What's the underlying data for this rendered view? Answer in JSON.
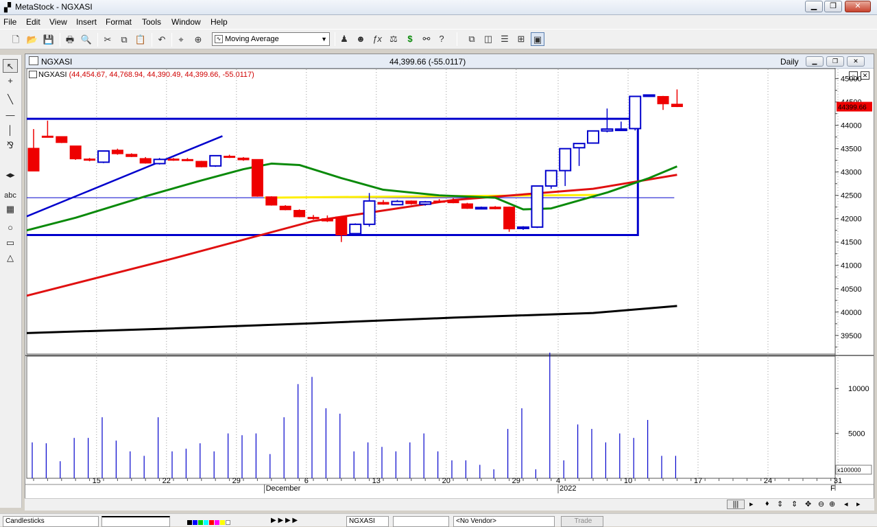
{
  "window": {
    "title": "MetaStock - NGXASI"
  },
  "menu": [
    "File",
    "Edit",
    "View",
    "Insert",
    "Format",
    "Tools",
    "Window",
    "Help"
  ],
  "toolbar": {
    "indicator_value": "Moving Average"
  },
  "chart_window": {
    "symbol": "NGXASI",
    "last_quote": "44,399.66 (-55.0117)",
    "period": "Daily",
    "legend_symbol": "NGXASI",
    "legend_values": "(44,454.67, 44,768.94, 44,390.49, 44,399.66, -55.0117)",
    "price_marker": "44399.66",
    "volume_multiplier": "x100000"
  },
  "status": {
    "style_field": "Candlesticks",
    "symbol_field": "NGXASI",
    "vendor_field": "<No Vendor>",
    "trade_button": "Trade"
  },
  "colors": {
    "bull_candle": "#0000cc",
    "bear_candle": "#ee0000",
    "ma_green": "#0a8a0a",
    "ma_red": "#e01010",
    "ma_black": "#000000",
    "support_yellow": "#ffef00"
  },
  "chart_data": {
    "type": "candlestick",
    "price_axis": {
      "ylim": [
        39100,
        45200
      ],
      "ticks": [
        39500,
        40000,
        40500,
        41000,
        41500,
        42000,
        42500,
        43000,
        43500,
        44000,
        44500,
        45000
      ]
    },
    "volume_axis": {
      "ylim": [
        0,
        13000
      ],
      "ticks": [
        5000,
        10000
      ]
    },
    "x_tick_labels": [
      "15",
      "22",
      "29",
      "6",
      "13",
      "20",
      "29",
      "4",
      "10",
      "17",
      "24",
      "31"
    ],
    "x_tick_idx": [
      4.5,
      9.5,
      14.5,
      19.5,
      24.5,
      29.5,
      34.5,
      37.5,
      42.5,
      47.5,
      52.5,
      57.5
    ],
    "month_labels": [
      {
        "label": "December",
        "idx": 16.5
      },
      {
        "label": "2022",
        "idx": 37.5
      }
    ],
    "candles": [
      [
        43510,
        43920,
        43020,
        43020
      ],
      [
        43770,
        44100,
        43740,
        43760
      ],
      [
        43760,
        43760,
        43620,
        43630
      ],
      [
        43560,
        43560,
        43260,
        43280
      ],
      [
        43280,
        43300,
        43230,
        43250
      ],
      [
        43210,
        43460,
        43190,
        43450
      ],
      [
        43470,
        43500,
        43370,
        43390
      ],
      [
        43380,
        43400,
        43320,
        43330
      ],
      [
        43290,
        43320,
        43180,
        43190
      ],
      [
        43180,
        43300,
        43160,
        43270
      ],
      [
        43280,
        43300,
        43240,
        43260
      ],
      [
        43270,
        43300,
        43230,
        43250
      ],
      [
        43230,
        43240,
        43100,
        43110
      ],
      [
        43130,
        43360,
        43110,
        43350
      ],
      [
        43340,
        43370,
        43300,
        43310
      ],
      [
        43300,
        43320,
        43240,
        43260
      ],
      [
        43270,
        43270,
        42470,
        42480
      ],
      [
        42470,
        42480,
        42280,
        42290
      ],
      [
        42270,
        42290,
        42180,
        42190
      ],
      [
        42180,
        42200,
        42030,
        42040
      ],
      [
        42030,
        42080,
        41980,
        42000
      ],
      [
        42000,
        42070,
        41930,
        41950
      ],
      [
        42040,
        42060,
        41500,
        41650
      ],
      [
        41680,
        41900,
        41650,
        41880
      ],
      [
        41880,
        42550,
        41830,
        42380
      ],
      [
        42350,
        42400,
        42300,
        42310
      ],
      [
        42300,
        42400,
        42290,
        42370
      ],
      [
        42380,
        42390,
        42300,
        42320
      ],
      [
        42310,
        42380,
        42280,
        42360
      ],
      [
        42380,
        42420,
        42340,
        42370
      ],
      [
        42400,
        42440,
        42330,
        42340
      ],
      [
        42320,
        42340,
        42210,
        42220
      ],
      [
        42230,
        42260,
        42200,
        42240
      ],
      [
        42250,
        42270,
        42200,
        42210
      ],
      [
        42250,
        42260,
        41720,
        41780
      ],
      [
        41800,
        41840,
        41760,
        41820
      ],
      [
        41820,
        42700,
        41800,
        42700
      ],
      [
        42700,
        43030,
        42640,
        43030
      ],
      [
        43030,
        43500,
        42700,
        43500
      ],
      [
        43520,
        43600,
        43130,
        43610
      ],
      [
        43620,
        43890,
        43610,
        43880
      ],
      [
        43880,
        44360,
        43850,
        43920
      ],
      [
        43900,
        44080,
        43880,
        43920
      ],
      [
        43930,
        44620,
        43890,
        44620
      ],
      [
        44640,
        44660,
        44610,
        44650
      ],
      [
        44620,
        44630,
        44330,
        44460
      ],
      [
        44454.67,
        44768.94,
        44390.49,
        44399.66
      ]
    ],
    "ma_green": [
      [
        0,
        41750
      ],
      [
        3,
        42020
      ],
      [
        8,
        42480
      ],
      [
        12,
        42820
      ],
      [
        15,
        43060
      ],
      [
        17,
        43180
      ],
      [
        19,
        43150
      ],
      [
        22,
        42870
      ],
      [
        25,
        42620
      ],
      [
        29,
        42500
      ],
      [
        33,
        42450
      ],
      [
        35,
        42200
      ],
      [
        37,
        42220
      ],
      [
        41,
        42560
      ],
      [
        44,
        42870
      ],
      [
        46,
        43120
      ]
    ],
    "ma_red": [
      [
        0,
        40350
      ],
      [
        10,
        41150
      ],
      [
        20,
        41950
      ],
      [
        30,
        42400
      ],
      [
        40,
        42640
      ],
      [
        46,
        42940
      ]
    ],
    "ma_black": [
      [
        0,
        39550
      ],
      [
        10,
        39650
      ],
      [
        20,
        39760
      ],
      [
        30,
        39880
      ],
      [
        40,
        39980
      ],
      [
        46,
        40130
      ]
    ],
    "trend_line": [
      [
        0,
        42050
      ],
      [
        13.5,
        43770
      ]
    ],
    "resistance": 44140,
    "support": 41650,
    "horizontal_line": 42450,
    "yellow_line": [
      [
        16.5,
        42450
      ],
      [
        40.5,
        42510
      ]
    ],
    "rect_end_idx": 43.2,
    "volumes": [
      4000,
      3900,
      1900,
      4500,
      4500,
      6800,
      4200,
      3000,
      2500,
      6800,
      3000,
      3300,
      3900,
      3000,
      5000,
      4800,
      5000,
      2700,
      6800,
      10500,
      11300,
      7800,
      7200,
      3000,
      4000,
      3500,
      3000,
      4000,
      5000,
      3000,
      2000,
      2000,
      1500,
      1000,
      5500,
      7800,
      1000,
      14000,
      2000,
      6000,
      5500,
      4000,
      5000,
      4500,
      6500,
      2500,
      2500
    ]
  }
}
